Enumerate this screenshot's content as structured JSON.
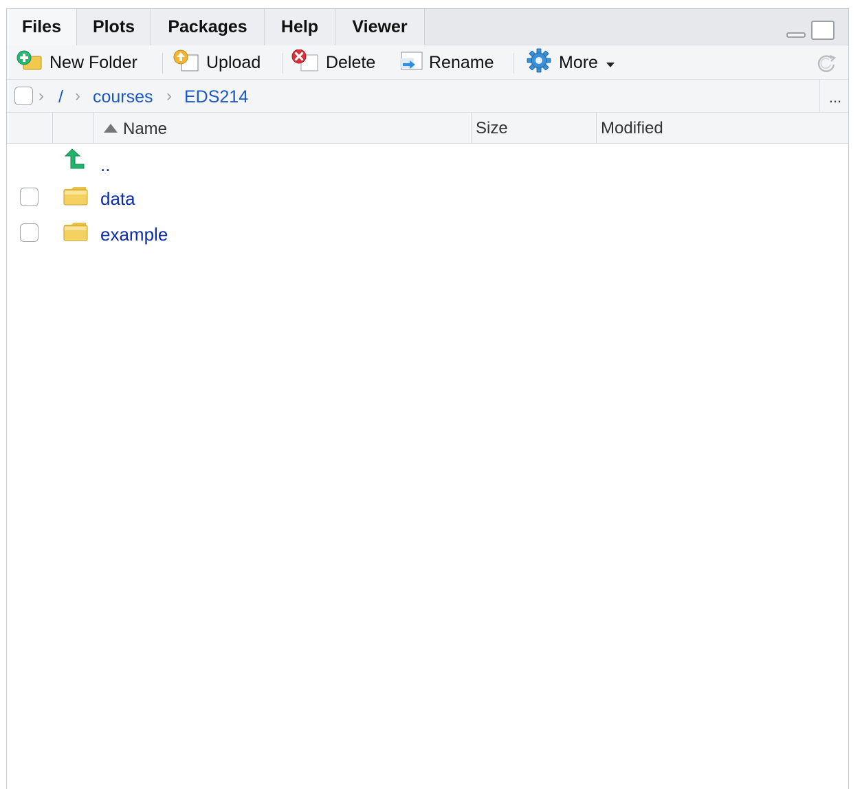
{
  "tabs": [
    {
      "label": "Files",
      "active": true
    },
    {
      "label": "Plots"
    },
    {
      "label": "Packages"
    },
    {
      "label": "Help"
    },
    {
      "label": "Viewer"
    }
  ],
  "toolbar": {
    "new_folder": "New Folder",
    "upload": "Upload",
    "delete": "Delete",
    "rename": "Rename",
    "more": "More"
  },
  "breadcrumb": {
    "root": "/",
    "items": [
      "courses",
      "EDS214"
    ],
    "overflow": "..."
  },
  "columns": {
    "name": "Name",
    "size": "Size",
    "modified": "Modified"
  },
  "rows": [
    {
      "name": "..",
      "type": "parent"
    },
    {
      "name": "data",
      "type": "folder"
    },
    {
      "name": "example",
      "type": "folder"
    }
  ],
  "icons": {
    "new_folder": "folder-plus-icon",
    "upload": "upload-icon",
    "delete": "delete-icon",
    "rename": "rename-icon",
    "more": "gear-icon",
    "refresh": "refresh-icon",
    "parent": "up-arrow-icon",
    "folder": "folder-icon"
  },
  "colors": {
    "link": "#1a57c8",
    "file_link": "#0b2ea8",
    "up_arrow": "#21b36b"
  }
}
